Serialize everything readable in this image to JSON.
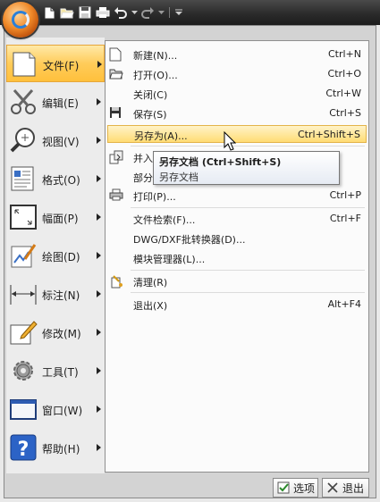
{
  "quick_access": {
    "icons": [
      "app-menu-icon",
      "new-icon",
      "open-icon",
      "save-icon",
      "print-icon",
      "undo-icon",
      "redo-icon",
      "customize-icon"
    ]
  },
  "categories": [
    {
      "label": "文件(F)",
      "icon": "file-icon",
      "active": true
    },
    {
      "label": "编辑(E)",
      "icon": "scissors-icon"
    },
    {
      "label": "视图(V)",
      "icon": "view-zoom-icon"
    },
    {
      "label": "格式(O)",
      "icon": "format-icon"
    },
    {
      "label": "幅面(P)",
      "icon": "sheet-icon"
    },
    {
      "label": "绘图(D)",
      "icon": "draw-icon"
    },
    {
      "label": "标注(N)",
      "icon": "dimension-icon"
    },
    {
      "label": "修改(M)",
      "icon": "modify-icon"
    },
    {
      "label": "工具(T)",
      "icon": "gear-icon"
    },
    {
      "label": "窗口(W)",
      "icon": "window-icon"
    },
    {
      "label": "帮助(H)",
      "icon": "help-icon"
    }
  ],
  "file_menu": {
    "items": [
      {
        "label": "新建(N)...",
        "shortcut": "Ctrl+N",
        "icon": "new-icon"
      },
      {
        "label": "打开(O)...",
        "shortcut": "Ctrl+O",
        "icon": "open-icon"
      },
      {
        "label": "关闭(C)",
        "shortcut": "Ctrl+W",
        "icon": ""
      },
      {
        "label": "保存(S)",
        "shortcut": "Ctrl+S",
        "icon": "save-icon"
      },
      {
        "label": "另存为(A)...",
        "shortcut": "Ctrl+Shift+S",
        "icon": "",
        "highlighted": true
      },
      {
        "label": "并入",
        "shortcut": "",
        "icon": "merge-icon"
      },
      {
        "label": "部分",
        "shortcut": "",
        "icon": ""
      },
      {
        "label": "打印(P)...",
        "shortcut": "Ctrl+P",
        "icon": "print-icon"
      },
      {
        "label": "文件检索(F)...",
        "shortcut": "Ctrl+F",
        "icon": ""
      },
      {
        "label": "DWG/DXF批转换器(D)...",
        "shortcut": "",
        "icon": ""
      },
      {
        "label": "模块管理器(L)...",
        "shortcut": "",
        "icon": ""
      },
      {
        "label": "清理(R)",
        "shortcut": "",
        "icon": "clean-icon"
      },
      {
        "label": "退出(X)",
        "shortcut": "Alt+F4",
        "icon": ""
      }
    ]
  },
  "tooltip": {
    "title": "另存文档 (Ctrl+Shift+S)",
    "description": "另存文档"
  },
  "buttons": {
    "options_label": "选项",
    "exit_label": "退出"
  },
  "colors": {
    "highlight_top": "#ffe9a8",
    "highlight_bottom": "#ffc03c",
    "toolbar_dark": "#2b2b2b"
  }
}
